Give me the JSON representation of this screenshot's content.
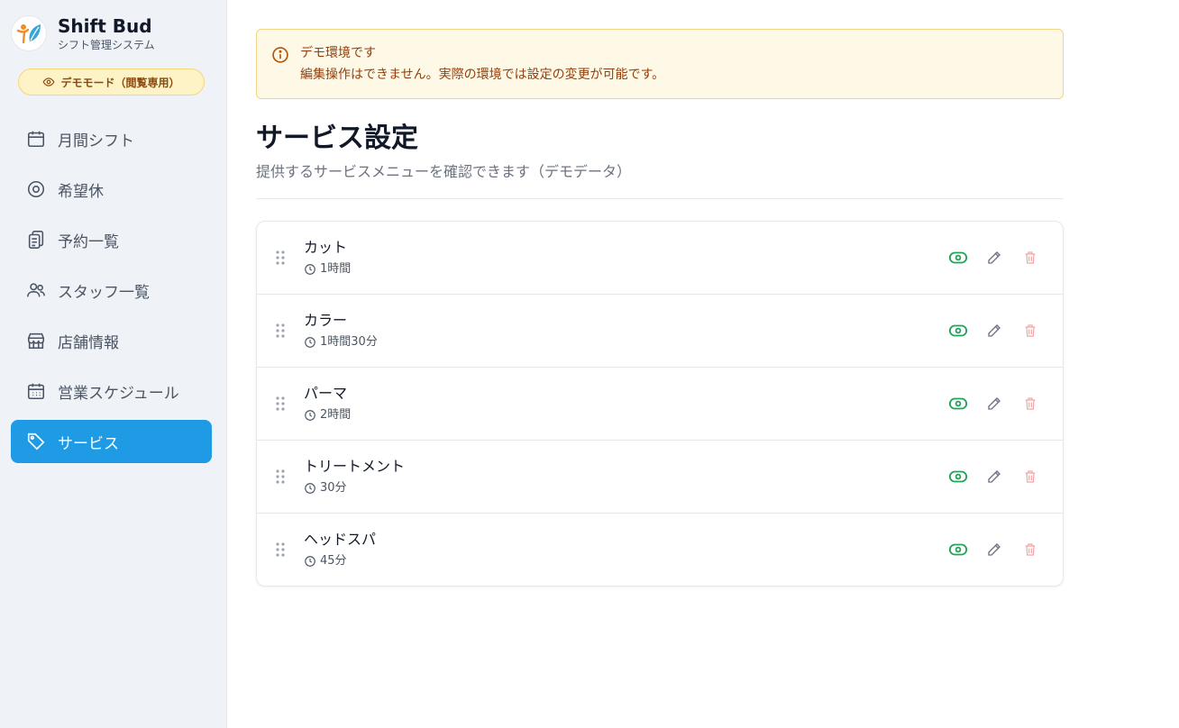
{
  "brand": {
    "title": "Shift Bud",
    "subtitle": "シフト管理システム"
  },
  "demo_badge": "デモモード（閲覧専用）",
  "nav": {
    "items": [
      {
        "label": "月間シフト",
        "icon": "calendar-icon",
        "active": false
      },
      {
        "label": "希望休",
        "icon": "circle-target-icon",
        "active": false
      },
      {
        "label": "予約一覧",
        "icon": "clipboard-list-icon",
        "active": false
      },
      {
        "label": "スタッフ一覧",
        "icon": "users-icon",
        "active": false
      },
      {
        "label": "店舗情報",
        "icon": "store-icon",
        "active": false
      },
      {
        "label": "営業スケジュール",
        "icon": "calendar-grid-icon",
        "active": false
      },
      {
        "label": "サービス",
        "icon": "tag-icon",
        "active": true
      }
    ]
  },
  "alert": {
    "title": "デモ環境です",
    "text": "編集操作はできません。実際の環境では設定の変更が可能です。"
  },
  "page": {
    "title": "サービス設定",
    "subtitle": "提供するサービスメニューを確認できます（デモデータ）"
  },
  "services": [
    {
      "name": "カット",
      "duration": "1時間"
    },
    {
      "name": "カラー",
      "duration": "1時間30分"
    },
    {
      "name": "パーマ",
      "duration": "2時間"
    },
    {
      "name": "トリートメント",
      "duration": "30分"
    },
    {
      "name": "ヘッドスパ",
      "duration": "45分"
    }
  ],
  "colors": {
    "accent": "#1f9be6",
    "visible_green": "#22a35a",
    "delete_red": "#f3a4a4",
    "alert_text": "#92400e"
  }
}
